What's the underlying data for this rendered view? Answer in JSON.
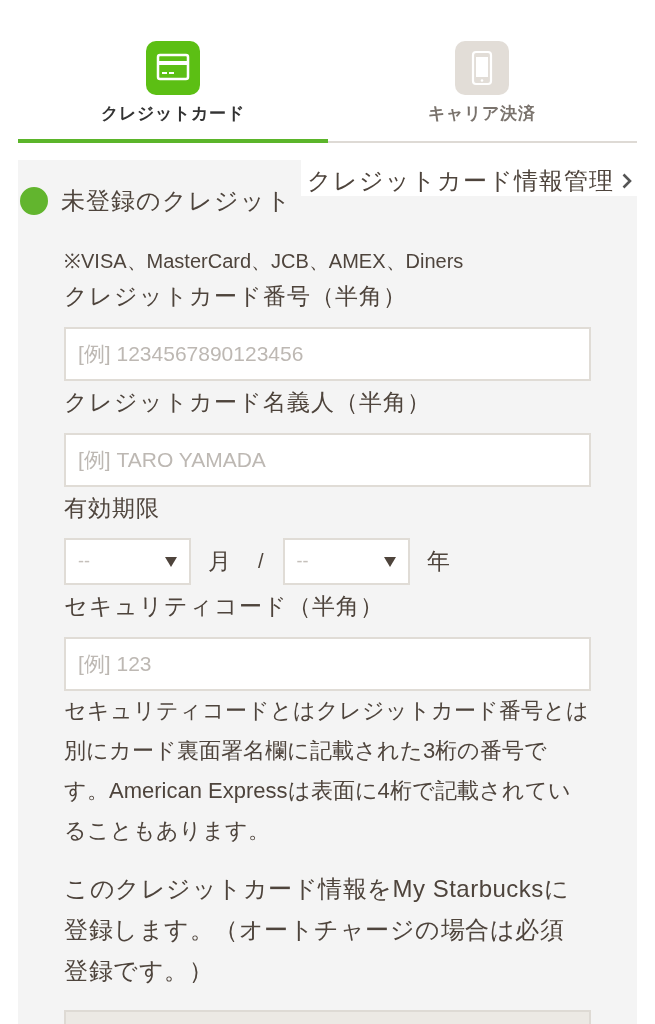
{
  "tabs": [
    {
      "label": "クレジットカード",
      "kind": "card",
      "selected": true
    },
    {
      "label": "キャリア決済",
      "kind": "phone",
      "selected": false
    }
  ],
  "card_panel": {
    "option": {
      "label": "未登録のクレジット",
      "selected": true
    },
    "manage_link": "クレジットカード情報管理",
    "accepted_brands": "※VISA、MasterCard、JCB、AMEX、Diners",
    "fields": [
      {
        "kind": "text",
        "label": "クレジットカード番号（半角）",
        "placeholder": "[例] 1234567890123456"
      },
      {
        "kind": "text",
        "label": "クレジットカード名義人（半角）",
        "placeholder": "[例] TARO YAMADA"
      },
      {
        "kind": "expiry",
        "label": "有効期限",
        "separator": "/",
        "selects": [
          {
            "placeholder": "--",
            "unit": "月"
          },
          {
            "placeholder": "--",
            "unit": "年"
          }
        ]
      },
      {
        "kind": "text",
        "label": "セキュリティコード（半角）",
        "placeholder": "[例] 123"
      }
    ],
    "security_note": "セキュリティコードとはクレジットカード番号とは別にカード裏面署名欄に記載された3桁の番号です。American Expressは表面に4桁で記載されていることもあります。",
    "register_note": "このクレジットカード情報をMy Starbucksに登録します。（オートチャージの場合は必須登録です。）"
  }
}
